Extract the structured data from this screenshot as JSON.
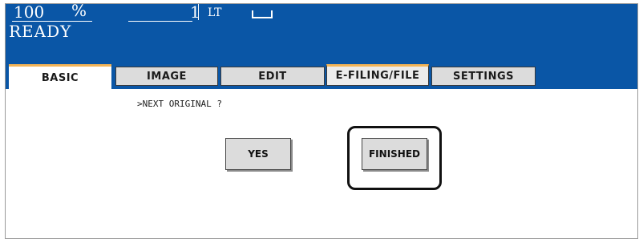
{
  "status": {
    "zoom": "100",
    "zoom_unit": "%",
    "ready": "READY",
    "copies": "1",
    "paper_size": "LT"
  },
  "tabs": [
    {
      "label": "BASIC"
    },
    {
      "label": "IMAGE"
    },
    {
      "label": "EDIT"
    },
    {
      "label": "E-FILING/FILE"
    },
    {
      "label": "SETTINGS"
    }
  ],
  "main": {
    "prompt": ">NEXT ORIGINAL ?",
    "yes_label": "YES",
    "finished_label": "FINISHED"
  },
  "colors": {
    "status_bar": "#0a56a6",
    "tab_accent": "#f3b457",
    "button_face": "#dcdcdc"
  },
  "icons": [
    "tray-icon"
  ]
}
